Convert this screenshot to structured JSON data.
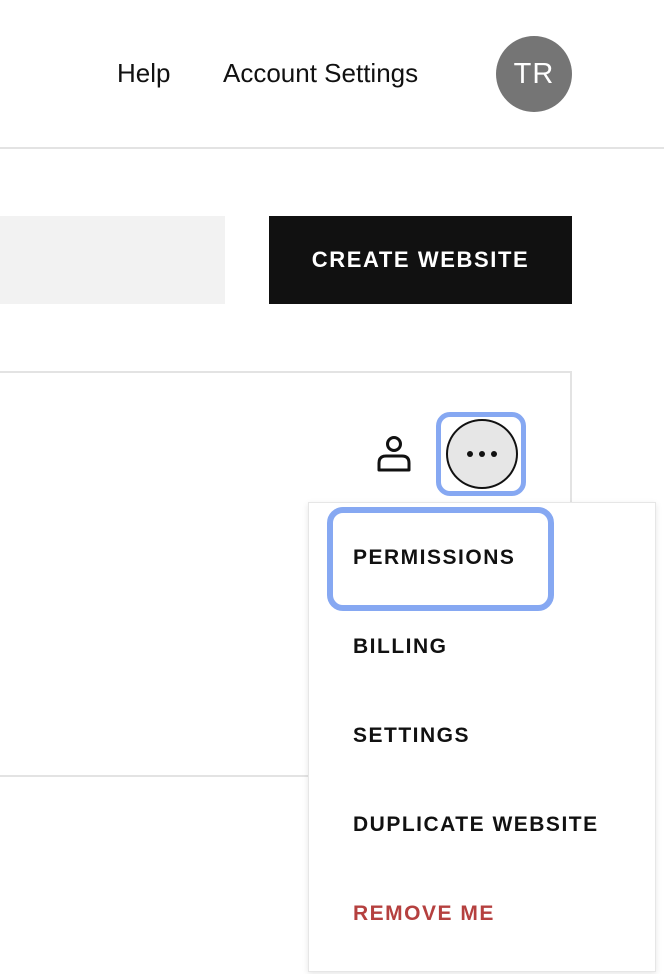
{
  "header": {
    "help_label": "Help",
    "account_settings_label": "Account Settings",
    "avatar_initials": "TR"
  },
  "toolbar": {
    "create_website_label": "CREATE WEBSITE"
  },
  "site_card": {
    "more_icon": "more-horizontal-icon",
    "person_icon": "person-icon"
  },
  "menu": {
    "items": [
      {
        "label": "PERMISSIONS",
        "focused": true
      },
      {
        "label": "BILLING"
      },
      {
        "label": "SETTINGS"
      },
      {
        "label": "DUPLICATE WEBSITE"
      },
      {
        "label": "REMOVE ME",
        "color": "#b5403f"
      }
    ]
  },
  "colors": {
    "focus_ring": "#86a8f2",
    "danger": "#b5403f",
    "button_bg": "#111111",
    "avatar_bg": "#757575"
  }
}
